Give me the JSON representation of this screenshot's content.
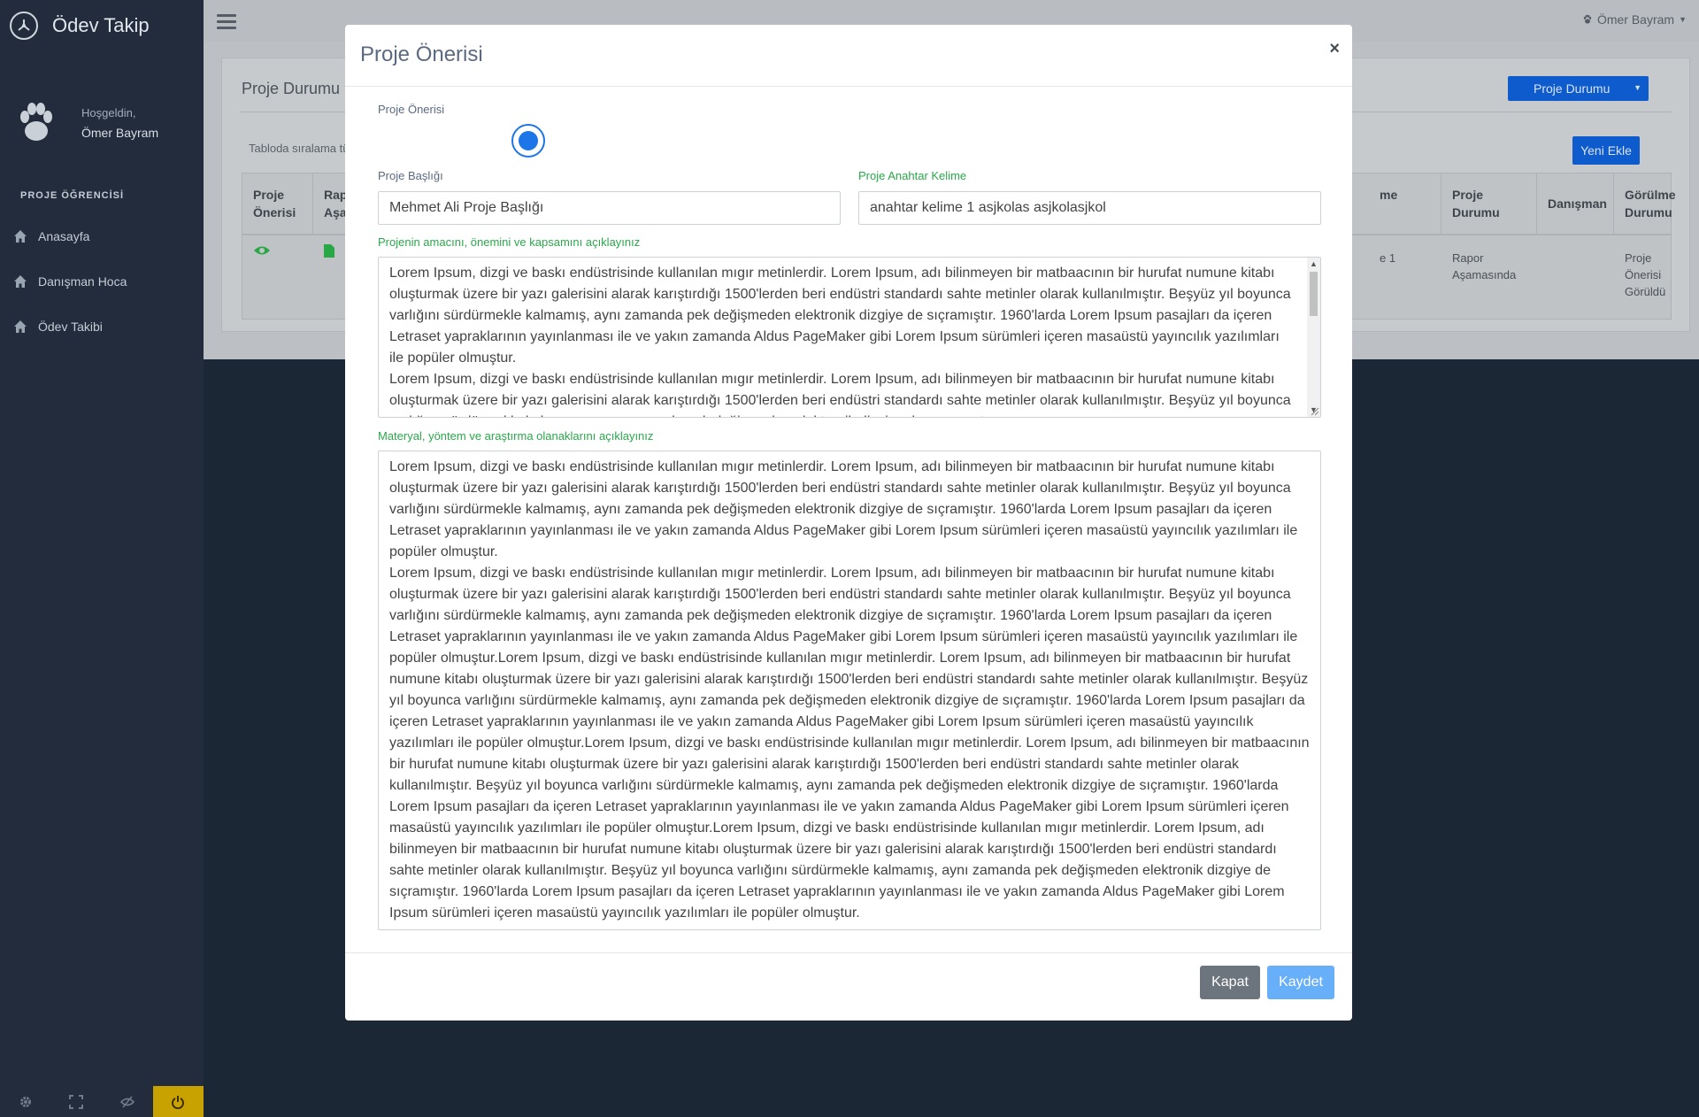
{
  "sidebar": {
    "app_title": "Ödev Takip",
    "welcome": "Hoşgeldin,",
    "user_name": "Ömer Bayram",
    "section_title": "PROJE ÖĞRENCİSİ",
    "items": [
      {
        "label": "Anasayfa",
        "icon": "home-icon"
      },
      {
        "label": "Danışman Hoca",
        "icon": "home-icon"
      },
      {
        "label": "Ödev Takibi",
        "icon": "home-icon"
      }
    ],
    "footer_icons": [
      "settings-icon",
      "fullscreen-icon",
      "eye-slash-icon",
      "power-icon"
    ],
    "power_color": "#c8a200"
  },
  "topbar": {
    "user_name": "Ömer Bayram"
  },
  "page": {
    "card_title": "Proje Durumu",
    "status_button": "Proje Durumu",
    "table_hint": "Tabloda sıralama tü",
    "new_button": "Yeni Ekle",
    "table": {
      "headers": [
        {
          "line1": "Proje",
          "line2": "Önerisi"
        },
        {
          "line1": "Rapo",
          "line2": "Aşam"
        },
        {
          "line1": "",
          "line2": "me"
        },
        {
          "line1": "Proje",
          "line2": "Durumu"
        },
        {
          "line1": "Danışman",
          "line2": ""
        },
        {
          "line1": "Görülme",
          "line2": "Durumu"
        }
      ],
      "row": {
        "partial_cell": "e 1",
        "proje_durumu_1": "Rapor",
        "proje_durumu_2": "Aşamasında",
        "danisman": "",
        "gorulme_1": "Proje",
        "gorulme_2": "Önerisi",
        "gorulme_3": "Görüldü"
      }
    }
  },
  "modal": {
    "title": "Proje Önerisi",
    "close_glyph": "×",
    "radio_label": "Proje Önerisi",
    "radio_checked": true,
    "title_label": "Proje Başlığı",
    "title_value": "Mehmet Ali Proje Başlığı",
    "keyword_label": "Proje Anahtar Kelime",
    "keyword_value": "anahtar kelime 1 asjkolas asjkolasjkol",
    "purpose_label": "Projenin amacını, önemini ve kapsamını açıklayınız",
    "purpose_text": "Lorem Ipsum, dizgi ve baskı endüstrisinde kullanılan mıgır metinlerdir. Lorem Ipsum, adı bilinmeyen bir matbaacının bir hurufat numune kitabı oluşturmak üzere bir yazı galerisini alarak karıştırdığı 1500'lerden beri endüstri standardı sahte metinler olarak kullanılmıştır. Beşyüz yıl boyunca varlığını sürdürmekle kalmamış, aynı zamanda pek değişmeden elektronik dizgiye de sıçramıştır. 1960'larda Lorem Ipsum pasajları da içeren Letraset yapraklarının yayınlanması ile ve yakın zamanda Aldus PageMaker gibi Lorem Ipsum sürümleri içeren masaüstü yayıncılık yazılımları ile popüler olmuştur.\nLorem Ipsum, dizgi ve baskı endüstrisinde kullanılan mıgır metinlerdir. Lorem Ipsum, adı bilinmeyen bir matbaacının bir hurufat numune kitabı oluşturmak üzere bir yazı galerisini alarak karıştırdığı 1500'lerden beri endüstri standardı sahte metinler olarak kullanılmıştır. Beşyüz yıl boyunca varlığını sürdürmekle kalmamış, aynı zamanda pek değişmeden elektronik dizgiye de sıçramıştır.",
    "material_label": "Materyal, yöntem ve araştırma olanaklarını açıklayınız",
    "material_text": "Lorem Ipsum, dizgi ve baskı endüstrisinde kullanılan mıgır metinlerdir. Lorem Ipsum, adı bilinmeyen bir matbaacının bir hurufat numune kitabı oluşturmak üzere bir yazı galerisini alarak karıştırdığı 1500'lerden beri endüstri standardı sahte metinler olarak kullanılmıştır. Beşyüz yıl boyunca varlığını sürdürmekle kalmamış, aynı zamanda pek değişmeden elektronik dizgiye de sıçramıştır. 1960'larda Lorem Ipsum pasajları da içeren Letraset yapraklarının yayınlanması ile ve yakın zamanda Aldus PageMaker gibi Lorem Ipsum sürümleri içeren masaüstü yayıncılık yazılımları ile popüler olmuştur.\nLorem Ipsum, dizgi ve baskı endüstrisinde kullanılan mıgır metinlerdir. Lorem Ipsum, adı bilinmeyen bir matbaacının bir hurufat numune kitabı oluşturmak üzere bir yazı galerisini alarak karıştırdığı 1500'lerden beri endüstri standardı sahte metinler olarak kullanılmıştır. Beşyüz yıl boyunca varlığını sürdürmekle kalmamış, aynı zamanda pek değişmeden elektronik dizgiye de sıçramıştır. 1960'larda Lorem Ipsum pasajları da içeren Letraset yapraklarının yayınlanması ile ve yakın zamanda Aldus PageMaker gibi Lorem Ipsum sürümleri içeren masaüstü yayıncılık yazılımları ile popüler olmuştur.Lorem Ipsum, dizgi ve baskı endüstrisinde kullanılan mıgır metinlerdir. Lorem Ipsum, adı bilinmeyen bir matbaacının bir hurufat numune kitabı oluşturmak üzere bir yazı galerisini alarak karıştırdığı 1500'lerden beri endüstri standardı sahte metinler olarak kullanılmıştır. Beşyüz yıl boyunca varlığını sürdürmekle kalmamış, aynı zamanda pek değişmeden elektronik dizgiye de sıçramıştır. 1960'larda Lorem Ipsum pasajları da içeren Letraset yapraklarının yayınlanması ile ve yakın zamanda Aldus PageMaker gibi Lorem Ipsum sürümleri içeren masaüstü yayıncılık yazılımları ile popüler olmuştur.Lorem Ipsum, dizgi ve baskı endüstrisinde kullanılan mıgır metinlerdir. Lorem Ipsum, adı bilinmeyen bir matbaacının bir hurufat numune kitabı oluşturmak üzere bir yazı galerisini alarak karıştırdığı 1500'lerden beri endüstri standardı sahte metinler olarak kullanılmıştır. Beşyüz yıl boyunca varlığını sürdürmekle kalmamış, aynı zamanda pek değişmeden elektronik dizgiye de sıçramıştır. 1960'larda Lorem Ipsum pasajları da içeren Letraset yapraklarının yayınlanması ile ve yakın zamanda Aldus PageMaker gibi Lorem Ipsum sürümleri içeren masaüstü yayıncılık yazılımları ile popüler olmuştur.Lorem Ipsum, dizgi ve baskı endüstrisinde kullanılan mıgır metinlerdir. Lorem Ipsum, adı bilinmeyen bir matbaacının bir hurufat numune kitabı oluşturmak üzere bir yazı galerisini alarak karıştırdığı 1500'lerden beri endüstri standardı sahte metinler olarak kullanılmıştır. Beşyüz yıl boyunca varlığını sürdürmekle kalmamış, aynı zamanda pek değişmeden elektronik dizgiye de sıçramıştır. 1960'larda Lorem Ipsum pasajları da içeren Letraset yapraklarının yayınlanması ile ve yakın zamanda Aldus PageMaker gibi Lorem Ipsum sürümleri içeren masaüstü yayıncılık yazılımları ile popüler olmuştur.",
    "close_button": "Kapat",
    "save_button": "Kaydet",
    "colors": {
      "primary": "#1d76e8",
      "green_label": "#2aa84a",
      "save": "#67aff9",
      "close": "#6c757d"
    }
  }
}
